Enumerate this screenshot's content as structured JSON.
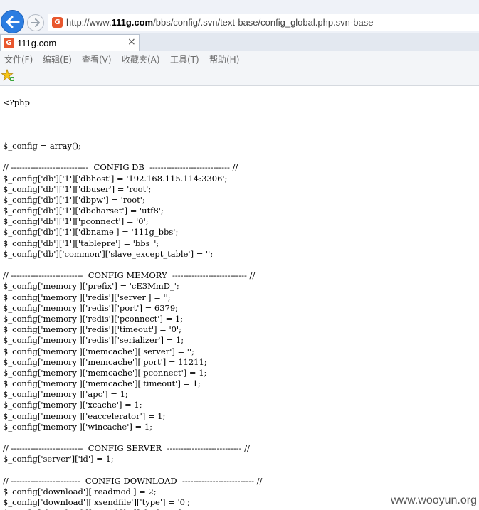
{
  "address_bar": {
    "url_prefix": "http://www.",
    "url_domain": "111g.com",
    "url_suffix": "/bbs/config/.svn/text-base/config_global.php.svn-base",
    "favicon_letter": "G"
  },
  "tab": {
    "title": "111g.com",
    "close": "×"
  },
  "menu": [
    {
      "label": "文件(F)"
    },
    {
      "label": "编辑(E)"
    },
    {
      "label": "查看(V)"
    },
    {
      "label": "收藏夹(A)"
    },
    {
      "label": "工具(T)"
    },
    {
      "label": "帮助(H)"
    }
  ],
  "icons": {
    "back": "back-arrow-icon",
    "forward": "forward-arrow-icon",
    "favorites": "add-favorites-star-icon"
  },
  "colors": {
    "back_button": "#2b7de1",
    "favicon": "#e8572e"
  },
  "code_lines": [
    "",
    "<?php",
    "",
    "",
    "",
    "$_config = array();",
    "",
    "// ----------------------------  CONFIG DB  ----------------------------- //",
    "$_config['db']['1']['dbhost'] = '192.168.115.114:3306';",
    "$_config['db']['1']['dbuser'] = 'root';",
    "$_config['db']['1']['dbpw'] = 'root';",
    "$_config['db']['1']['dbcharset'] = 'utf8';",
    "$_config['db']['1']['pconnect'] = '0';",
    "$_config['db']['1']['dbname'] = '111g_bbs';",
    "$_config['db']['1']['tablepre'] = 'bbs_';",
    "$_config['db']['common']['slave_except_table'] = '';",
    "",
    "// --------------------------  CONFIG MEMORY  --------------------------- //",
    "$_config['memory']['prefix'] = 'cE3MmD_';",
    "$_config['memory']['redis']['server'] = '';",
    "$_config['memory']['redis']['port'] = 6379;",
    "$_config['memory']['redis']['pconnect'] = 1;",
    "$_config['memory']['redis']['timeout'] = '0';",
    "$_config['memory']['redis']['serializer'] = 1;",
    "$_config['memory']['memcache']['server'] = '';",
    "$_config['memory']['memcache']['port'] = 11211;",
    "$_config['memory']['memcache']['pconnect'] = 1;",
    "$_config['memory']['memcache']['timeout'] = 1;",
    "$_config['memory']['apc'] = 1;",
    "$_config['memory']['xcache'] = 1;",
    "$_config['memory']['eaccelerator'] = 1;",
    "$_config['memory']['wincache'] = 1;",
    "",
    "// --------------------------  CONFIG SERVER  --------------------------- //",
    "$_config['server']['id'] = 1;",
    "",
    "// -------------------------  CONFIG DOWNLOAD  -------------------------- //",
    "$_config['download']['readmod'] = 2;",
    "$_config['download']['xsendfile']['type'] = '0';",
    "$_config['download']['xsendfile']['dir'] = '/down/';"
  ],
  "watermark": "www.wooyun.org"
}
